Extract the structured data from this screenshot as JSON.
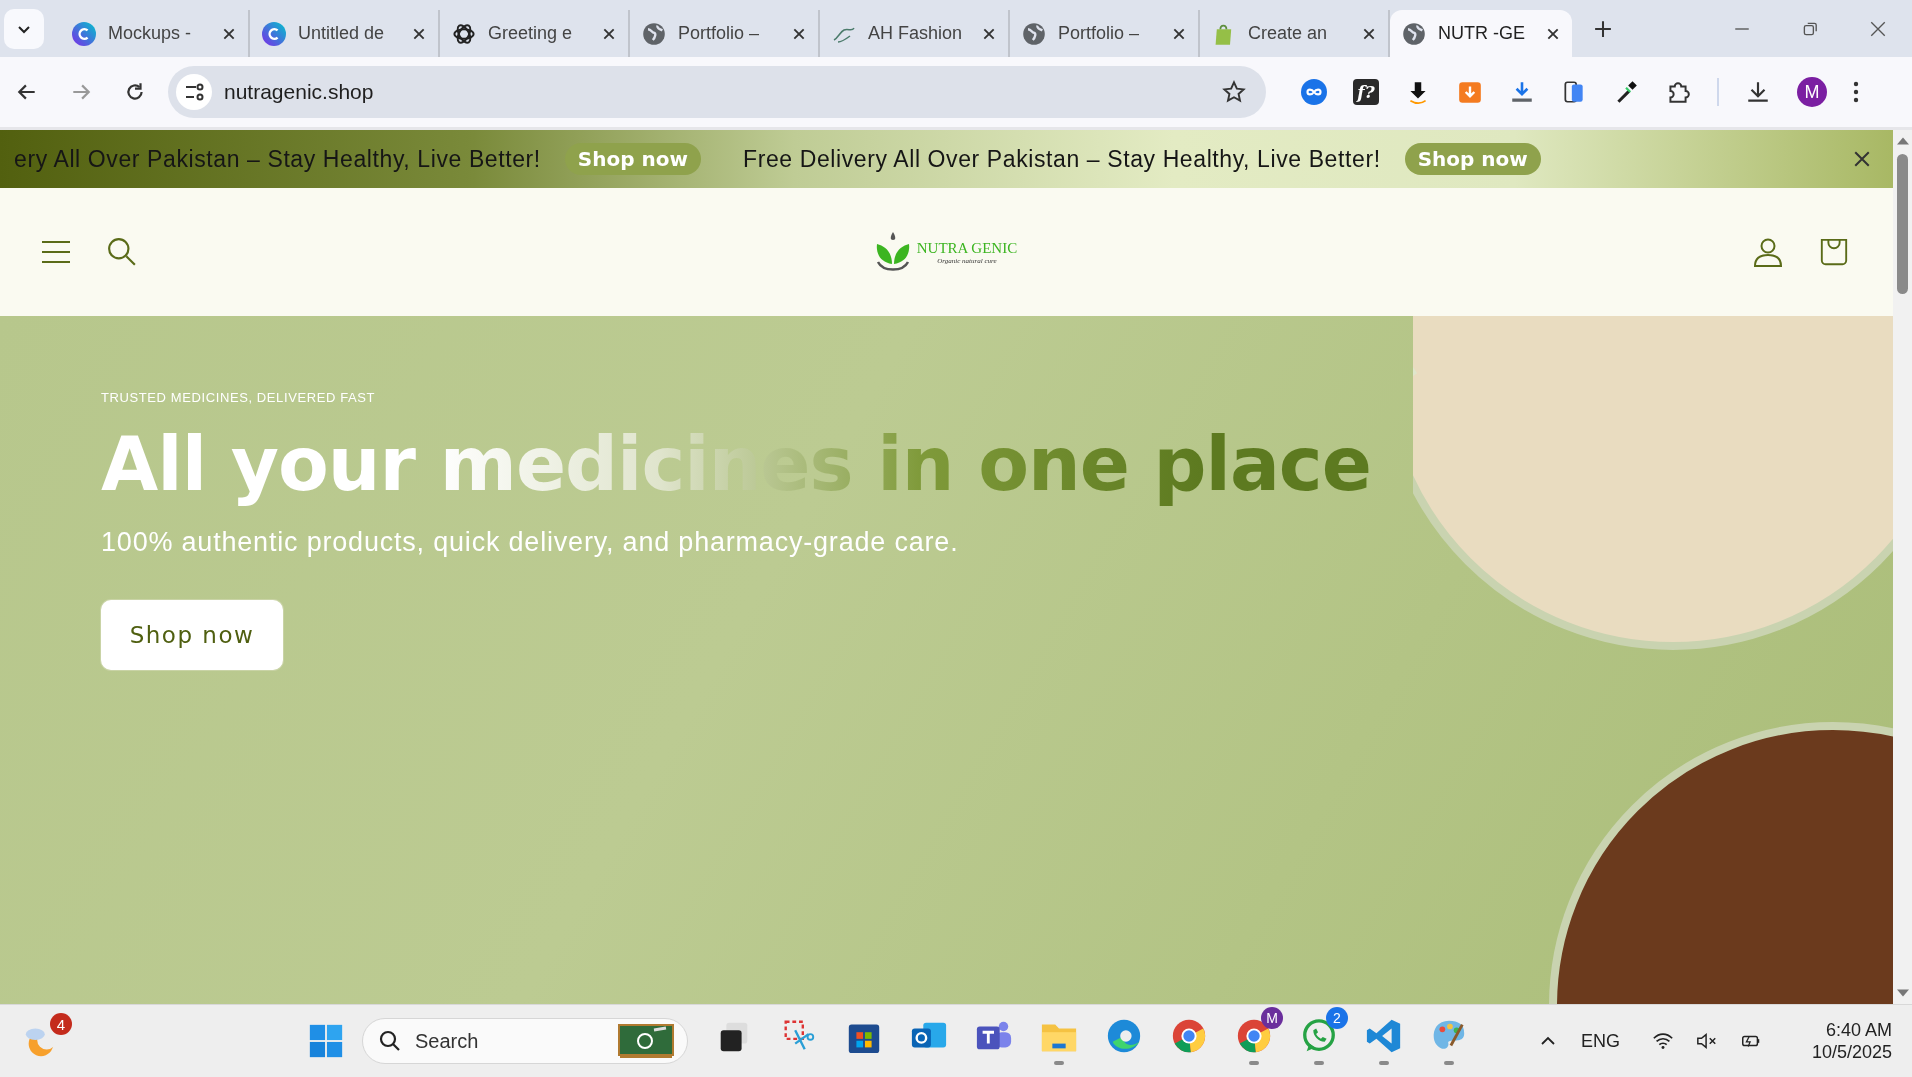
{
  "browser": {
    "tabs": [
      {
        "title": "Mockups -",
        "kind": "canva",
        "selected": false
      },
      {
        "title": "Untitled de",
        "kind": "canva",
        "selected": false
      },
      {
        "title": "Greeting e",
        "kind": "openai",
        "selected": false
      },
      {
        "title": "Portfolio –",
        "kind": "globe",
        "selected": false
      },
      {
        "title": "AH Fashion",
        "kind": "sketch",
        "selected": false
      },
      {
        "title": "Portfolio –",
        "kind": "globe",
        "selected": false
      },
      {
        "title": "Create an",
        "kind": "shopify",
        "selected": false
      },
      {
        "title": "NUTR -GE",
        "kind": "globe",
        "selected": true
      }
    ],
    "address": {
      "url": "nutragenic.shop"
    },
    "extensions": [
      {
        "kind": "loop"
      },
      {
        "kind": "fonts",
        "label": "f?"
      },
      {
        "kind": "amazon-download"
      },
      {
        "kind": "orange-download"
      },
      {
        "kind": "download-bar"
      },
      {
        "kind": "phone"
      },
      {
        "kind": "eyedropper"
      },
      {
        "kind": "puzzle"
      }
    ],
    "profile": {
      "initial": "M"
    }
  },
  "announcement": {
    "items": [
      {
        "text": "ery All Over Pakistan – Stay Healthy, Live Better!",
        "button": "Shop now"
      },
      {
        "text": "Free Delivery All Over Pakistan – Stay Healthy, Live Better!",
        "button": "Shop now"
      }
    ]
  },
  "header": {
    "logo": {
      "name": "NUTRA GENIC",
      "tagline": "Organic natural cure"
    }
  },
  "hero": {
    "eyebrow": "TRUSTED MEDICINES, DELIVERED FAST",
    "heading": "All your medicines in one place",
    "subheading": "100% authentic products, quick delivery, and pharmacy-grade care.",
    "button": "Shop now"
  },
  "taskbar": {
    "widget_badge": "4",
    "search": {
      "placeholder": "Search"
    },
    "apps": [
      {
        "kind": "taskview",
        "running": false
      },
      {
        "kind": "snipping",
        "running": false
      },
      {
        "kind": "store",
        "running": false
      },
      {
        "kind": "outlook",
        "running": false
      },
      {
        "kind": "teams",
        "running": false
      },
      {
        "kind": "explorer",
        "running": true
      },
      {
        "kind": "edge",
        "running": false
      },
      {
        "kind": "chrome",
        "running": false
      },
      {
        "kind": "chrome",
        "running": true,
        "badge": "M"
      },
      {
        "kind": "whatsapp",
        "running": true,
        "badge": "2"
      },
      {
        "kind": "vscode",
        "running": true
      },
      {
        "kind": "paint",
        "running": true
      }
    ],
    "tray": {
      "language": "ENG",
      "time": "6:40 AM",
      "date": "10/5/2025"
    }
  }
}
